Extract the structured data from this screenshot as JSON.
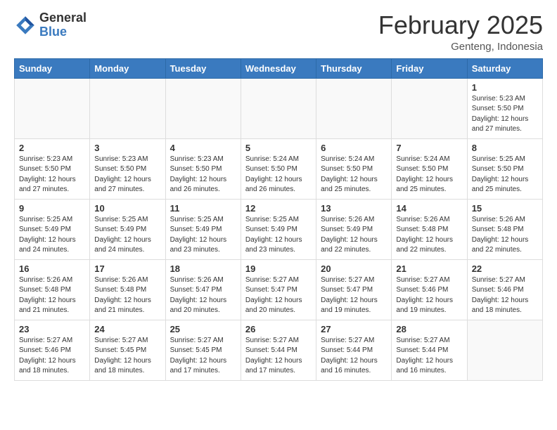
{
  "logo": {
    "general": "General",
    "blue": "Blue"
  },
  "header": {
    "title": "February 2025",
    "subtitle": "Genteng, Indonesia"
  },
  "days_of_week": [
    "Sunday",
    "Monday",
    "Tuesday",
    "Wednesday",
    "Thursday",
    "Friday",
    "Saturday"
  ],
  "weeks": [
    [
      {
        "day": "",
        "info": ""
      },
      {
        "day": "",
        "info": ""
      },
      {
        "day": "",
        "info": ""
      },
      {
        "day": "",
        "info": ""
      },
      {
        "day": "",
        "info": ""
      },
      {
        "day": "",
        "info": ""
      },
      {
        "day": "1",
        "info": "Sunrise: 5:23 AM\nSunset: 5:50 PM\nDaylight: 12 hours\nand 27 minutes."
      }
    ],
    [
      {
        "day": "2",
        "info": "Sunrise: 5:23 AM\nSunset: 5:50 PM\nDaylight: 12 hours\nand 27 minutes."
      },
      {
        "day": "3",
        "info": "Sunrise: 5:23 AM\nSunset: 5:50 PM\nDaylight: 12 hours\nand 27 minutes."
      },
      {
        "day": "4",
        "info": "Sunrise: 5:23 AM\nSunset: 5:50 PM\nDaylight: 12 hours\nand 26 minutes."
      },
      {
        "day": "5",
        "info": "Sunrise: 5:24 AM\nSunset: 5:50 PM\nDaylight: 12 hours\nand 26 minutes."
      },
      {
        "day": "6",
        "info": "Sunrise: 5:24 AM\nSunset: 5:50 PM\nDaylight: 12 hours\nand 25 minutes."
      },
      {
        "day": "7",
        "info": "Sunrise: 5:24 AM\nSunset: 5:50 PM\nDaylight: 12 hours\nand 25 minutes."
      },
      {
        "day": "8",
        "info": "Sunrise: 5:25 AM\nSunset: 5:50 PM\nDaylight: 12 hours\nand 25 minutes."
      }
    ],
    [
      {
        "day": "9",
        "info": "Sunrise: 5:25 AM\nSunset: 5:49 PM\nDaylight: 12 hours\nand 24 minutes."
      },
      {
        "day": "10",
        "info": "Sunrise: 5:25 AM\nSunset: 5:49 PM\nDaylight: 12 hours\nand 24 minutes."
      },
      {
        "day": "11",
        "info": "Sunrise: 5:25 AM\nSunset: 5:49 PM\nDaylight: 12 hours\nand 23 minutes."
      },
      {
        "day": "12",
        "info": "Sunrise: 5:25 AM\nSunset: 5:49 PM\nDaylight: 12 hours\nand 23 minutes."
      },
      {
        "day": "13",
        "info": "Sunrise: 5:26 AM\nSunset: 5:49 PM\nDaylight: 12 hours\nand 22 minutes."
      },
      {
        "day": "14",
        "info": "Sunrise: 5:26 AM\nSunset: 5:48 PM\nDaylight: 12 hours\nand 22 minutes."
      },
      {
        "day": "15",
        "info": "Sunrise: 5:26 AM\nSunset: 5:48 PM\nDaylight: 12 hours\nand 22 minutes."
      }
    ],
    [
      {
        "day": "16",
        "info": "Sunrise: 5:26 AM\nSunset: 5:48 PM\nDaylight: 12 hours\nand 21 minutes."
      },
      {
        "day": "17",
        "info": "Sunrise: 5:26 AM\nSunset: 5:48 PM\nDaylight: 12 hours\nand 21 minutes."
      },
      {
        "day": "18",
        "info": "Sunrise: 5:26 AM\nSunset: 5:47 PM\nDaylight: 12 hours\nand 20 minutes."
      },
      {
        "day": "19",
        "info": "Sunrise: 5:27 AM\nSunset: 5:47 PM\nDaylight: 12 hours\nand 20 minutes."
      },
      {
        "day": "20",
        "info": "Sunrise: 5:27 AM\nSunset: 5:47 PM\nDaylight: 12 hours\nand 19 minutes."
      },
      {
        "day": "21",
        "info": "Sunrise: 5:27 AM\nSunset: 5:46 PM\nDaylight: 12 hours\nand 19 minutes."
      },
      {
        "day": "22",
        "info": "Sunrise: 5:27 AM\nSunset: 5:46 PM\nDaylight: 12 hours\nand 18 minutes."
      }
    ],
    [
      {
        "day": "23",
        "info": "Sunrise: 5:27 AM\nSunset: 5:46 PM\nDaylight: 12 hours\nand 18 minutes."
      },
      {
        "day": "24",
        "info": "Sunrise: 5:27 AM\nSunset: 5:45 PM\nDaylight: 12 hours\nand 18 minutes."
      },
      {
        "day": "25",
        "info": "Sunrise: 5:27 AM\nSunset: 5:45 PM\nDaylight: 12 hours\nand 17 minutes."
      },
      {
        "day": "26",
        "info": "Sunrise: 5:27 AM\nSunset: 5:44 PM\nDaylight: 12 hours\nand 17 minutes."
      },
      {
        "day": "27",
        "info": "Sunrise: 5:27 AM\nSunset: 5:44 PM\nDaylight: 12 hours\nand 16 minutes."
      },
      {
        "day": "28",
        "info": "Sunrise: 5:27 AM\nSunset: 5:44 PM\nDaylight: 12 hours\nand 16 minutes."
      },
      {
        "day": "",
        "info": ""
      }
    ]
  ]
}
